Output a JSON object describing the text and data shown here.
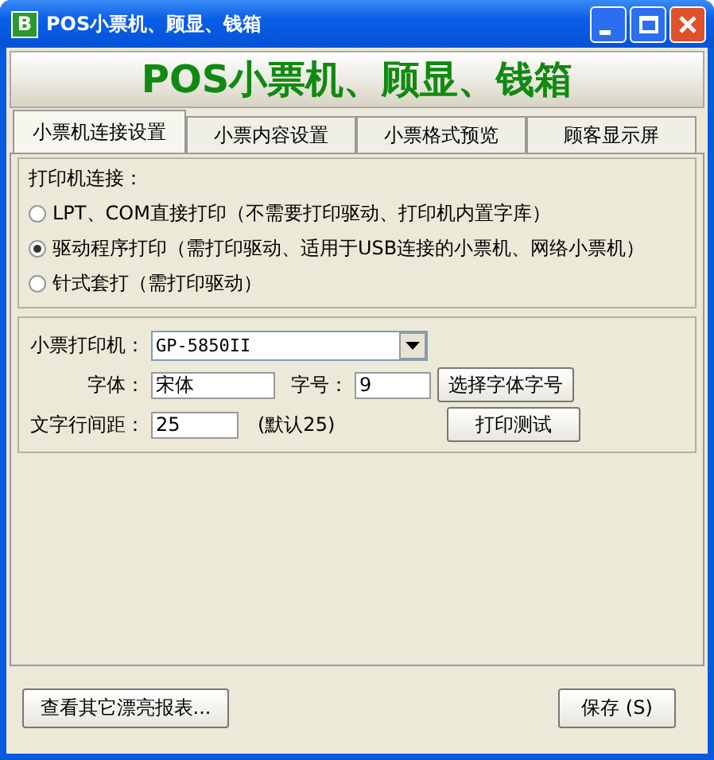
{
  "window": {
    "title": "POS小票机、顾显、钱箱",
    "icon_letter": "B"
  },
  "banner": "POS小票机、顾显、钱箱",
  "tabs": [
    {
      "label": "小票机连接设置",
      "selected": true
    },
    {
      "label": "小票内容设置",
      "selected": false
    },
    {
      "label": "小票格式预览",
      "selected": false
    },
    {
      "label": "顾客显示屏",
      "selected": false
    }
  ],
  "connection": {
    "label": "打印机连接：",
    "options": [
      {
        "label": "LPT、COM直接打印（不需要打印驱动、打印机内置字库）",
        "selected": false
      },
      {
        "label": "驱动程序打印（需打印驱动、适用于USB连接的小票机、网络小票机）",
        "selected": true
      },
      {
        "label": "针式套打（需打印驱动）",
        "selected": false
      }
    ]
  },
  "printer": {
    "label": "小票打印机：",
    "value": "GP-5850II"
  },
  "font": {
    "label": "字体：",
    "value": "宋体"
  },
  "size": {
    "label": "字号：",
    "value": "9"
  },
  "choose_font_button": "选择字体字号",
  "line_spacing": {
    "label": "文字行间距：",
    "value": "25",
    "hint": "(默认25)"
  },
  "test_print_button": "打印测试",
  "reports_button": "查看其它漂亮报表...",
  "save_button": "保存 (S)"
}
